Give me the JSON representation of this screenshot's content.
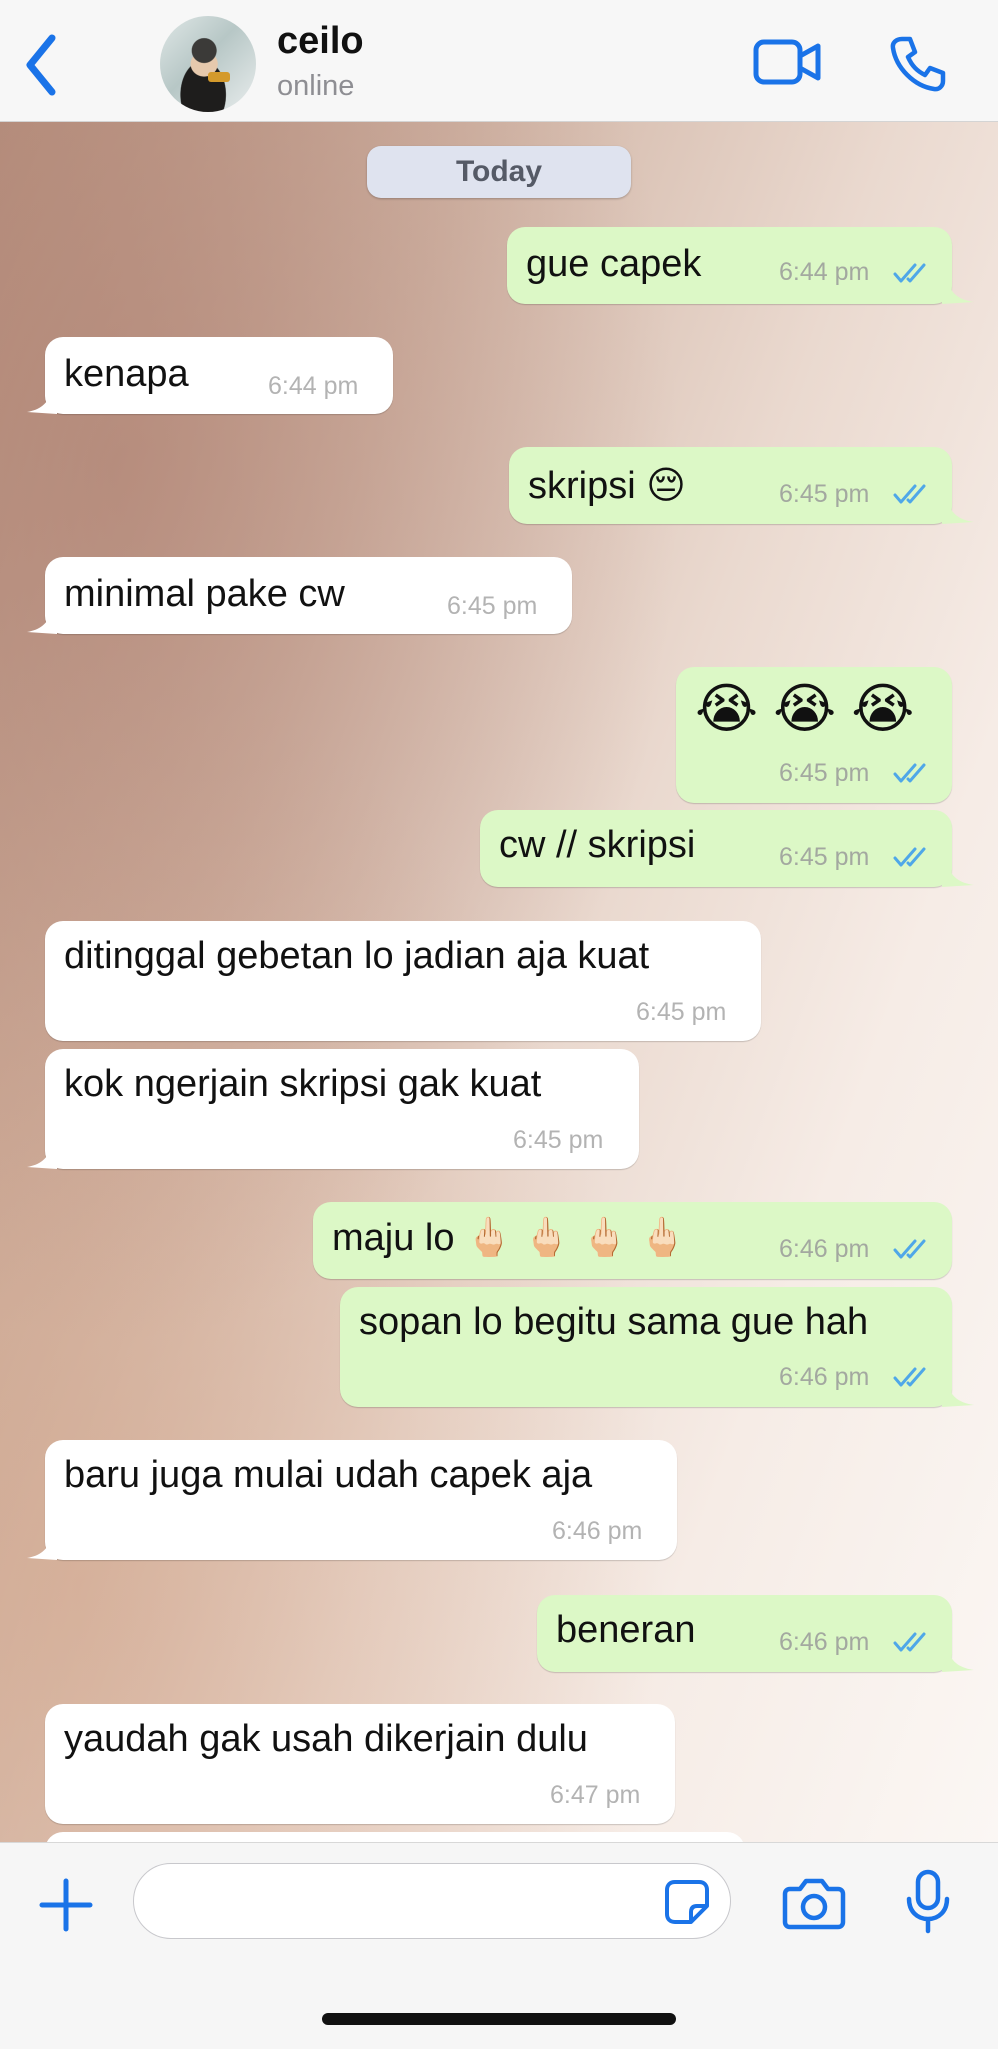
{
  "header": {
    "contact_name": "ceilo",
    "contact_status": "online"
  },
  "chat": {
    "date_label": "Today",
    "messages": [
      {
        "dir": "out",
        "text": "gue capek",
        "time": "6:44 pm"
      },
      {
        "dir": "in",
        "text": "kenapa",
        "time": "6:44 pm"
      },
      {
        "dir": "out",
        "text": "skripsi 😔",
        "time": "6:45 pm"
      },
      {
        "dir": "in",
        "text": "minimal pake cw",
        "time": "6:45 pm"
      },
      {
        "dir": "out",
        "text": "😭 😭 😭",
        "time": "6:45 pm"
      },
      {
        "dir": "out",
        "text": "cw // skripsi",
        "time": "6:45 pm"
      },
      {
        "dir": "in",
        "text": "ditinggal gebetan lo jadian aja kuat",
        "time": "6:45 pm"
      },
      {
        "dir": "in",
        "text": "kok ngerjain skripsi gak kuat",
        "time": "6:45 pm"
      },
      {
        "dir": "out",
        "text": "maju lo 🖕🏻 🖕🏻 🖕🏻 🖕🏻",
        "time": "6:46 pm"
      },
      {
        "dir": "out",
        "text": "sopan lo begitu sama gue hah",
        "time": "6:46 pm"
      },
      {
        "dir": "in",
        "text": "baru juga mulai udah capek aja",
        "time": "6:46 pm"
      },
      {
        "dir": "out",
        "text": "beneran",
        "time": "6:46 pm"
      },
      {
        "dir": "in",
        "text": "yaudah gak usah dikerjain dulu",
        "time": "6:47 pm"
      }
    ]
  },
  "icons": {
    "back": "chevron-left-icon",
    "video": "video-camera-icon",
    "call": "phone-icon",
    "add": "plus-icon",
    "sticker": "sticker-icon",
    "camera": "camera-icon",
    "mic": "microphone-icon",
    "read": "double-check-icon"
  },
  "colors": {
    "accent": "#1a73e8",
    "outgoing_bubble": "#dcf8c6",
    "incoming_bubble": "#ffffff",
    "read_ticks": "#4fa7e8"
  }
}
